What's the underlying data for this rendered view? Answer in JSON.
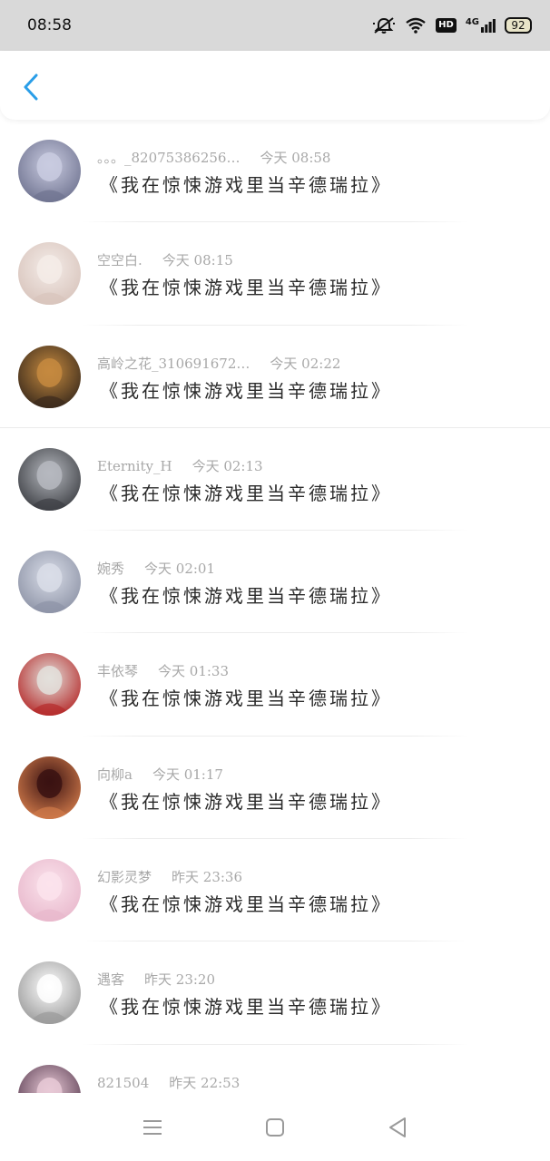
{
  "status": {
    "time": "08:58",
    "network": "4G",
    "hd": "HD",
    "battery": "92",
    "icons": [
      "mute-bell-icon",
      "wifi-icon",
      "hd-icon",
      "signal-icon",
      "battery-icon"
    ]
  },
  "header": {
    "back_icon": "chevron-left-icon",
    "accent": "#2a9ee8"
  },
  "items": [
    {
      "name": "。。。_82075386256…",
      "time": "今天 08:58",
      "message": "《我在惊悚游戏里当辛德瑞拉》",
      "avatar_colors": [
        "#c9cbe0",
        "#6f7390"
      ]
    },
    {
      "name": "空空白.",
      "time": "今天 08:15",
      "message": "《我在惊悚游戏里当辛德瑞拉》",
      "avatar_colors": [
        "#f4ece8",
        "#d8c4bc"
      ]
    },
    {
      "name": "高岭之花_310691672…",
      "time": "今天 02:22",
      "message": "《我在惊悚游戏里当辛德瑞拉》",
      "avatar_colors": [
        "#c58a3f",
        "#3a2a1c"
      ]
    },
    {
      "name": "Eternity_H",
      "time": "今天 02:13",
      "message": "《我在惊悚游戏里当辛德瑞拉》",
      "avatar_colors": [
        "#b6b9bf",
        "#3d3f44"
      ]
    },
    {
      "name": "婉秀",
      "time": "今天 02:01",
      "message": "《我在惊悚游戏里当辛德瑞拉》",
      "avatar_colors": [
        "#d9dde8",
        "#8d93a6"
      ]
    },
    {
      "name": "丰依琴",
      "time": "今天 01:33",
      "message": "《我在惊悚游戏里当辛德瑞拉》",
      "avatar_colors": [
        "#e3e1dc",
        "#b52a2a"
      ]
    },
    {
      "name": "向柳a",
      "time": "今天 01:17",
      "message": "《我在惊悚游戏里当辛德瑞拉》",
      "avatar_colors": [
        "#3a1212",
        "#d07a4a"
      ]
    },
    {
      "name": "幻影灵梦",
      "time": "昨天 23:36",
      "message": "《我在惊悚游戏里当辛德瑞拉》",
      "avatar_colors": [
        "#fbe3ec",
        "#e8b8cc"
      ]
    },
    {
      "name": "遇客",
      "time": "昨天 23:20",
      "message": "《我在惊悚游戏里当辛德瑞拉》",
      "avatar_colors": [
        "#ffffff",
        "#9a9a9a"
      ]
    },
    {
      "name": "821504",
      "time": "昨天 22:53",
      "message": "",
      "avatar_colors": [
        "#e8c9d6",
        "#5a3d52"
      ]
    }
  ],
  "navbar": {
    "icons": [
      "menu-icon",
      "home-square-icon",
      "back-triangle-icon"
    ]
  }
}
